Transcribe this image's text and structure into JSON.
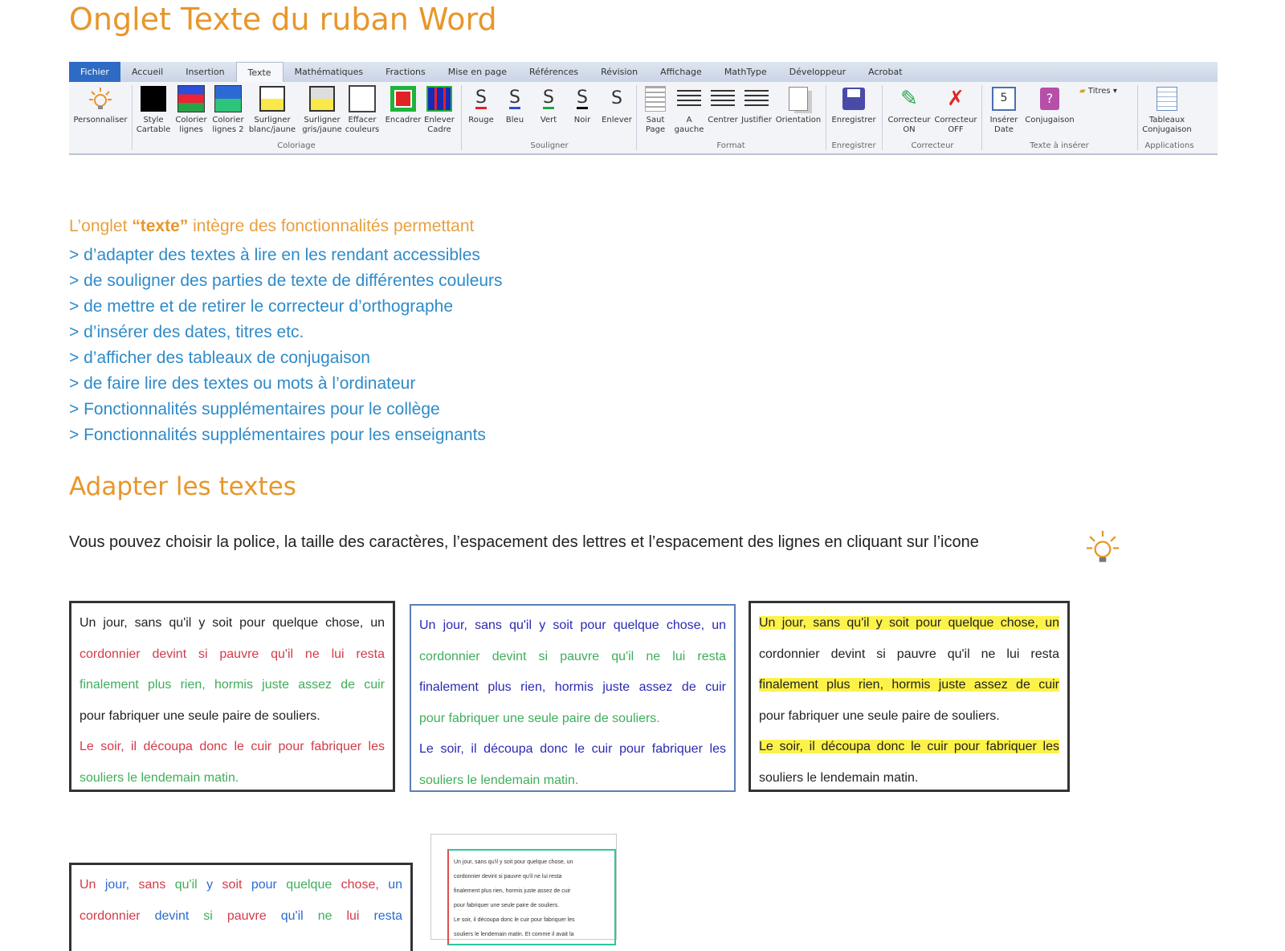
{
  "title": "Onglet Texte du ruban Word",
  "ribbon": {
    "tabs": [
      "Fichier",
      "Accueil",
      "Insertion",
      "Texte",
      "Mathématiques",
      "Fractions",
      "Mise en page",
      "Références",
      "Révision",
      "Affichage",
      "MathType",
      "Développeur",
      "Acrobat"
    ],
    "active_tab": "Texte",
    "tools": {
      "personnaliser": "Personnaliser",
      "style_cartable": "Style Cartable",
      "colorier_lignes": "Colorier lignes",
      "colorier_lignes2": "Colorier lignes 2",
      "surligner_bj": "Surligner blanc/jaune",
      "surligner_gj": "Surligner gris/jaune",
      "effacer_couleurs": "Effacer couleurs",
      "encadrer": "Encadrer",
      "enlever_cadre": "Enlever Cadre",
      "rouge": "Rouge",
      "bleu": "Bleu",
      "vert": "Vert",
      "noir": "Noir",
      "enlever": "Enlever",
      "saut_page": "Saut Page",
      "a_gauche": "A gauche",
      "centrer": "Centrer",
      "justifier": "Justifier",
      "orientation": "Orientation",
      "enregistrer": "Enregistrer",
      "correcteur_on": "Correcteur ON",
      "correcteur_off": "Correcteur OFF",
      "inserer_date": "Insérer Date",
      "conjugaison": "Conjugaison",
      "titres": "Titres",
      "tableaux_conjugaison": "Tableaux Conjugaison"
    },
    "groups": {
      "coloriage": "Coloriage",
      "souligner": "Souligner",
      "format": "Format",
      "enregistrer": "Enregistrer",
      "correcteur": "Correcteur",
      "texte_inserer": "Texte à insérer",
      "applications": "Applications"
    },
    "colors": {
      "file_tab": "#2e6bc4",
      "accent": "#E8962A",
      "link": "#2E8BC9"
    }
  },
  "intro": {
    "before": "L’onglet ",
    "bold": "“texte”",
    "after": " intègre des fonctionnalités permettant"
  },
  "links": [
    "> d’adapter des textes à lire en les rendant accessibles",
    "> de souligner des parties de texte de différentes couleurs",
    "> de mettre et de retirer le correcteur d’orthographe",
    "> d’insérer des dates, titres etc.",
    "> d’afficher des tableaux de conjugaison",
    "> de faire lire des textes ou mots à l’ordinateur",
    "> Fonctionnalités supplémentaires pour le collège",
    "> Fonctionnalités supplémentaires pour les enseignants"
  ],
  "section_title": "Adapter les textes",
  "paragraph": "Vous pouvez choisir la police, la taille des caractères, l’espacement des lettres et l’espacement des lignes en cliquant sur l’icone",
  "example_lines": [
    "Un jour, sans qu'il y soit pour quelque chose, un",
    "cordonnier devint si pauvre qu'il ne lui resta",
    "finalement plus rien, hormis juste assez de cuir",
    "pour fabriquer une seule paire de souliers.",
    "Le soir, il découpa donc le cuir pour fabriquer les",
    "souliers le lendemain matin."
  ],
  "example4_lines": [
    [
      "Un ",
      "jour, ",
      "sans ",
      "qu'il ",
      "y ",
      "soit ",
      "pour ",
      "quelque ",
      "chose, ",
      "un"
    ],
    [
      "cordonnier ",
      "devint ",
      "si ",
      "pauvre ",
      "qu'il ",
      "ne ",
      "lui ",
      "resta"
    ]
  ],
  "mini_lines": [
    "Un jour, sans qu'il y soit pour quelque chose, un",
    "cordonnier devint si pauvre qu'il ne lui resta",
    "finalement plus rien, hormis juste assez de cuir",
    "pour fabriquer une seule paire de souliers.",
    "Le soir, il découpa donc le cuir pour fabriquer les",
    "souliers le lendemain matin. Et comme il avait la"
  ]
}
